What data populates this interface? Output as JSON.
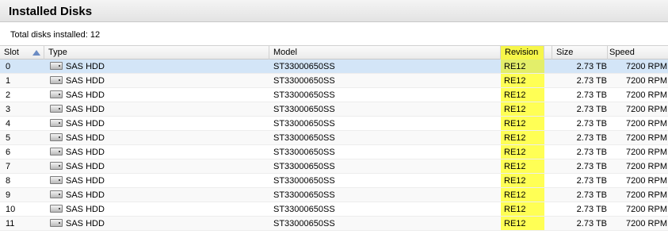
{
  "panel": {
    "title": "Installed Disks",
    "summary_label": "Total disks installed:",
    "summary_count": "12"
  },
  "table": {
    "columns": {
      "slot": "Slot",
      "type": "Type",
      "model": "Model",
      "revision": "Revision",
      "size": "Size",
      "speed": "Speed"
    },
    "sorted_by": "Slot",
    "sort_direction": "ascending",
    "highlight_color": "#ffff55",
    "selected_row_index": 0,
    "rows": [
      {
        "slot": "0",
        "type": "SAS HDD",
        "model": "ST33000650SS",
        "revision": "RE12",
        "size": "2.73 TB",
        "speed": "7200 RPM"
      },
      {
        "slot": "1",
        "type": "SAS HDD",
        "model": "ST33000650SS",
        "revision": "RE12",
        "size": "2.73 TB",
        "speed": "7200 RPM"
      },
      {
        "slot": "2",
        "type": "SAS HDD",
        "model": "ST33000650SS",
        "revision": "RE12",
        "size": "2.73 TB",
        "speed": "7200 RPM"
      },
      {
        "slot": "3",
        "type": "SAS HDD",
        "model": "ST33000650SS",
        "revision": "RE12",
        "size": "2.73 TB",
        "speed": "7200 RPM"
      },
      {
        "slot": "4",
        "type": "SAS HDD",
        "model": "ST33000650SS",
        "revision": "RE12",
        "size": "2.73 TB",
        "speed": "7200 RPM"
      },
      {
        "slot": "5",
        "type": "SAS HDD",
        "model": "ST33000650SS",
        "revision": "RE12",
        "size": "2.73 TB",
        "speed": "7200 RPM"
      },
      {
        "slot": "6",
        "type": "SAS HDD",
        "model": "ST33000650SS",
        "revision": "RE12",
        "size": "2.73 TB",
        "speed": "7200 RPM"
      },
      {
        "slot": "7",
        "type": "SAS HDD",
        "model": "ST33000650SS",
        "revision": "RE12",
        "size": "2.73 TB",
        "speed": "7200 RPM"
      },
      {
        "slot": "8",
        "type": "SAS HDD",
        "model": "ST33000650SS",
        "revision": "RE12",
        "size": "2.73 TB",
        "speed": "7200 RPM"
      },
      {
        "slot": "9",
        "type": "SAS HDD",
        "model": "ST33000650SS",
        "revision": "RE12",
        "size": "2.73 TB",
        "speed": "7200 RPM"
      },
      {
        "slot": "10",
        "type": "SAS HDD",
        "model": "ST33000650SS",
        "revision": "RE12",
        "size": "2.73 TB",
        "speed": "7200 RPM"
      },
      {
        "slot": "11",
        "type": "SAS HDD",
        "model": "ST33000650SS",
        "revision": "RE12",
        "size": "2.73 TB",
        "speed": "7200 RPM"
      }
    ]
  }
}
